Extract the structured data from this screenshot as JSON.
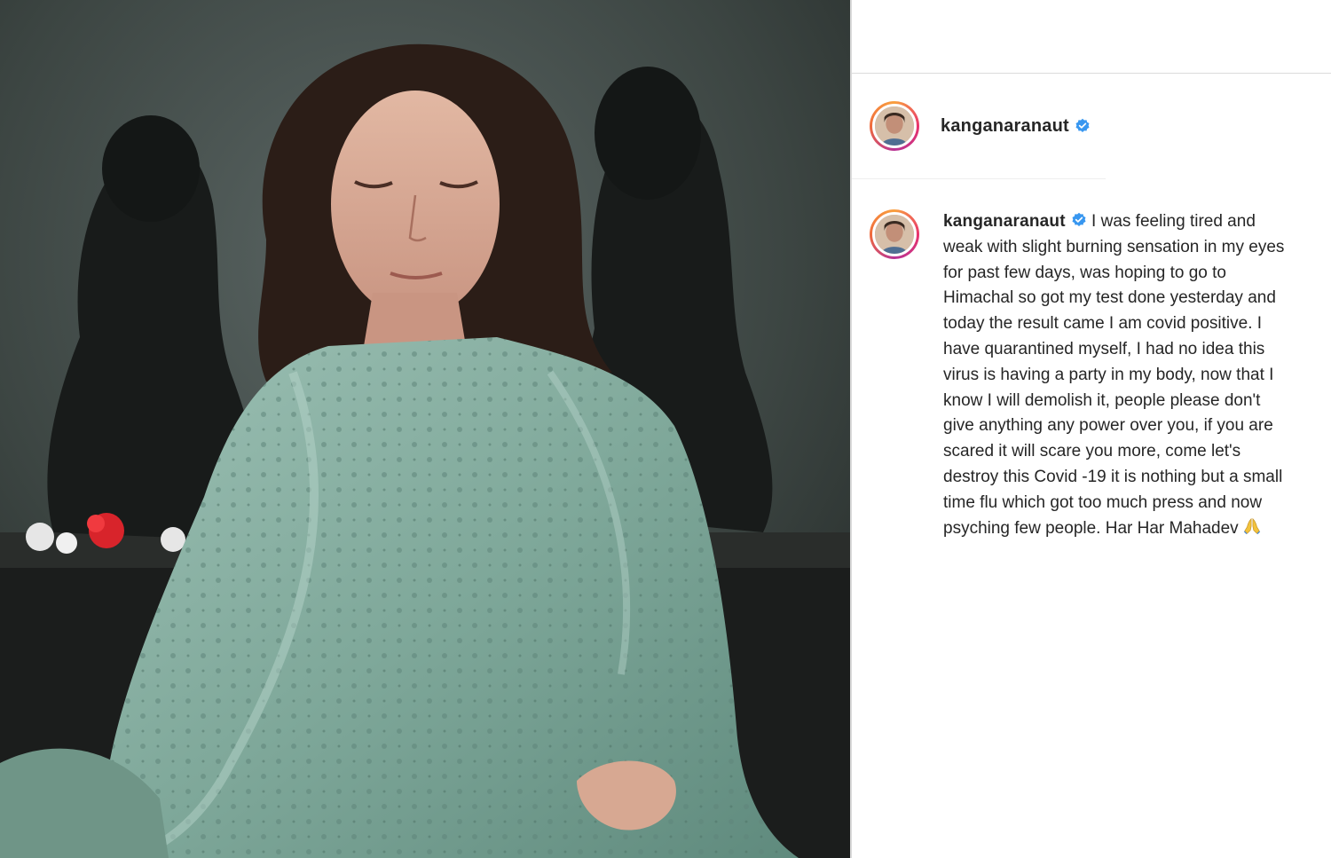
{
  "post": {
    "photo_alt": "",
    "header": {
      "username": "kanganaranaut",
      "verified_icon": "verified-badge-icon"
    },
    "caption": {
      "username": "kanganaranaut",
      "text": "I was feeling tired and weak with slight burning sensation in my eyes for past few days, was hoping to go to Himachal so got my test done yesterday and today the result came I am covid positive. I have quarantined myself, I had no idea this virus is having a party in my body, now that I know I will demolish it, people please don't give anything any power over you, if you are scared it will scare you more, come let's destroy this Covid -19 it is nothing but a small time flu which got too much press and now psyching few people. Har Har Mahadev",
      "emoji_icon": "folded-hands-icon"
    }
  },
  "colors": {
    "verified_blue": "#3897f0",
    "text": "#262626",
    "divider": "#dbdbdb"
  }
}
